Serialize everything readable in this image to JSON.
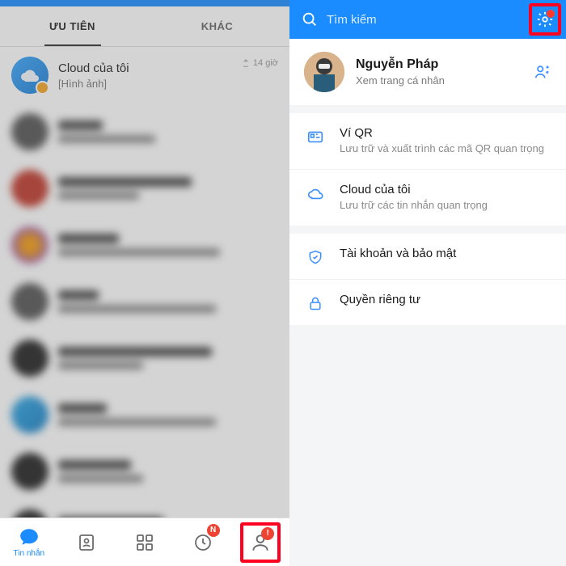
{
  "tabs": {
    "priority": "ƯU TIÊN",
    "other": "KHÁC"
  },
  "chats": {
    "cloud": {
      "name": "Cloud của tôi",
      "sub": "[Hình ảnh]",
      "time": "14 giờ"
    }
  },
  "bottomNav": {
    "messages": {
      "label": "Tin nhắn"
    },
    "badge_n": "N",
    "badge_alert": "!"
  },
  "search": {
    "placeholder": "Tìm kiếm"
  },
  "profile": {
    "name": "Nguyễn Pháp",
    "sub": "Xem trang cá nhân"
  },
  "options": {
    "qr": {
      "title": "Ví QR",
      "sub": "Lưu trữ và xuất trình các mã QR quan trọng"
    },
    "cloud": {
      "title": "Cloud của tôi",
      "sub": "Lưu trữ các tin nhắn quan trọng"
    },
    "security": {
      "title": "Tài khoản và bảo mật"
    },
    "privacy": {
      "title": "Quyền riêng tư"
    }
  },
  "colors": {
    "accent": "#1a8cff",
    "alert": "#ff0020"
  }
}
